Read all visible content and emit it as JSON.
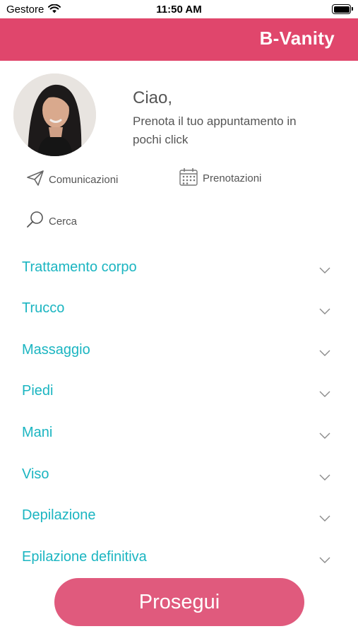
{
  "status_bar": {
    "carrier": "Gestore",
    "time": "11:50 AM"
  },
  "header": {
    "brand": "B-Vanity",
    "background_color": "#e0466c"
  },
  "profile": {
    "greeting": "Ciao,",
    "subtitle": "Prenota il tuo appuntamento in pochi click"
  },
  "actions": {
    "communications_label": "Comunicazioni",
    "bookings_label": "Prenotazioni",
    "search_label": "Cerca"
  },
  "categories": [
    {
      "label": "Trattamento corpo",
      "icon": "chevron-down-icon"
    },
    {
      "label": "Trucco",
      "icon": "chevron-down-icon"
    },
    {
      "label": "Massaggio",
      "icon": "chevron-down-icon"
    },
    {
      "label": "Piedi",
      "icon": "chevron-down-icon"
    },
    {
      "label": "Mani",
      "icon": "chevron-down-icon"
    },
    {
      "label": "Viso",
      "icon": "chevron-down-icon"
    },
    {
      "label": "Depilazione",
      "icon": "chevron-down-icon"
    },
    {
      "label": "Epilazione definitiva",
      "icon": "chevron-down-icon"
    }
  ],
  "category_color": "#1bb5c1",
  "proceed_button": {
    "label": "Prosegui",
    "color": "#e05a7d"
  }
}
